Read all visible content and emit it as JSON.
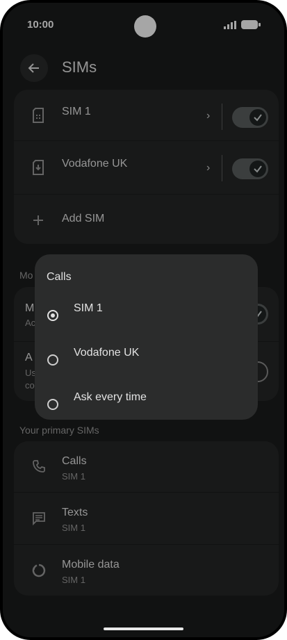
{
  "status_bar": {
    "time": "10:00"
  },
  "header": {
    "title": "SIMs"
  },
  "sims_card": {
    "items": [
      {
        "label": "SIM 1",
        "enabled": true
      },
      {
        "label": "Vodafone UK",
        "enabled": true
      }
    ],
    "add_label": "Add SIM"
  },
  "mobile_network": {
    "header_partial": "Mo",
    "row1_label_partial": "M",
    "row1_sub_partial": "Ac",
    "row2_label_partial": "A",
    "row2_sub_line1": "Us",
    "row2_sub_line2": "co"
  },
  "dialog": {
    "title": "Calls",
    "options": [
      {
        "label": "SIM 1",
        "selected": true
      },
      {
        "label": "Vodafone UK",
        "selected": false
      },
      {
        "label": "Ask every time",
        "selected": false
      }
    ]
  },
  "primary_sims": {
    "header": "Your primary SIMs",
    "items": [
      {
        "label": "Calls",
        "value": "SIM 1",
        "icon": "phone-icon"
      },
      {
        "label": "Texts",
        "value": "SIM 1",
        "icon": "message-icon"
      },
      {
        "label": "Mobile data",
        "value": "SIM 1",
        "icon": "data-icon"
      }
    ]
  },
  "colors": {
    "background": "#1b1c1c",
    "card": "#262727",
    "dialog": "#2b2c2c",
    "toggle": "#5b6060"
  }
}
